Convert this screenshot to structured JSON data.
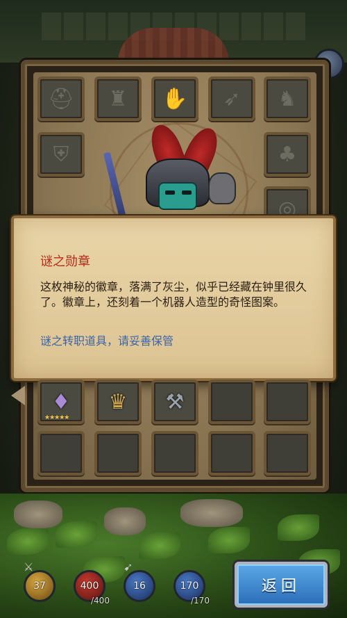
{
  "dialog": {
    "title": "谜之勋章",
    "description": "这枚神秘的徽章，落满了灰尘，似乎已经藏在钟里很久了。徽章上，还刻着一个机器人造型的奇怪图案。",
    "note": "谜之转职道具，请妥善保管"
  },
  "inventory": {
    "top_slots": [
      "helmet-icon",
      "armor-icon",
      "gauntlet-icon",
      "crossbow-icon",
      "boots-icon",
      "shield-icon",
      "cloak-icon",
      "ring-icon"
    ],
    "filled_items": [
      {
        "icon": "crystal-badge-icon",
        "stars": "★★★★★"
      },
      {
        "icon": "treasure-bag-icon",
        "stars": ""
      },
      {
        "icon": "hammer-icon",
        "stars": ""
      }
    ]
  },
  "stats": {
    "gold": "37",
    "health": "400",
    "health_max": "/400",
    "attack": "16",
    "mana": "170",
    "mana_max": "/170"
  },
  "buttons": {
    "back": "返回"
  },
  "colors": {
    "title_red": "#b52c1c",
    "note_blue": "#3b63a8",
    "button_blue": "#2a6eb8"
  }
}
